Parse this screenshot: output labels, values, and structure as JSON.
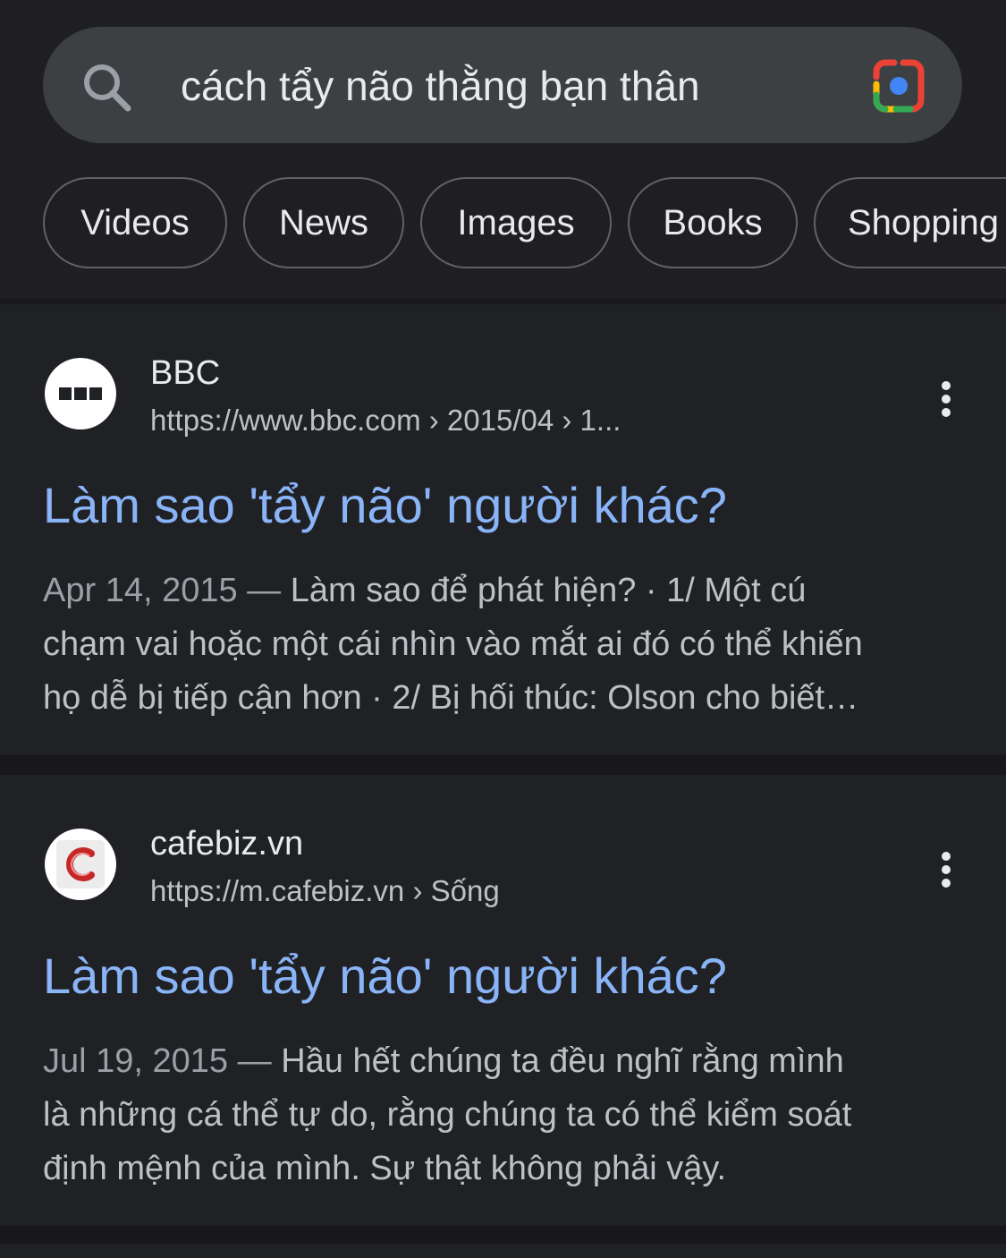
{
  "search": {
    "query": "cách tẩy não thằng bạn thân"
  },
  "chips": [
    {
      "label": "Videos"
    },
    {
      "label": "News"
    },
    {
      "label": "Images"
    },
    {
      "label": "Books"
    },
    {
      "label": "Shopping"
    }
  ],
  "results": [
    {
      "site_name": "BBC",
      "url": "https://www.bbc.com › 2015/04 › 1...",
      "title": "Làm sao 'tẩy não' người khác?",
      "date": "Apr 14, 2015",
      "snippet_line1": "Làm sao để phát hiện? · 1/ Một cú",
      "snippet_line2": "chạm vai hoặc một cái nhìn vào mắt ai đó có thể khiến",
      "snippet_line3": "họ dễ bị tiếp cận hơn · 2/ Bị hối thúc: Olson cho biết…",
      "icon": "bbc-logo-icon"
    },
    {
      "site_name": "cafebiz.vn",
      "url": "https://m.cafebiz.vn › Sống",
      "title": "Làm sao 'tẩy não' người khác?",
      "date": "Jul 19, 2015",
      "snippet_line1": "Hầu hết chúng ta đều nghĩ rằng mình",
      "snippet_line2": "là những cá thể tự do, rằng chúng ta có thể kiểm soát",
      "snippet_line3": "định mệnh của mình. Sự thật không phải vậy.",
      "icon": "cafebiz-logo-icon"
    }
  ],
  "separator": "—",
  "colors": {
    "background": "#202124",
    "search_bar": "#3c4043",
    "link": "#8ab4f8",
    "text": "#e8eaed",
    "secondary_text": "#bdc1c6"
  }
}
